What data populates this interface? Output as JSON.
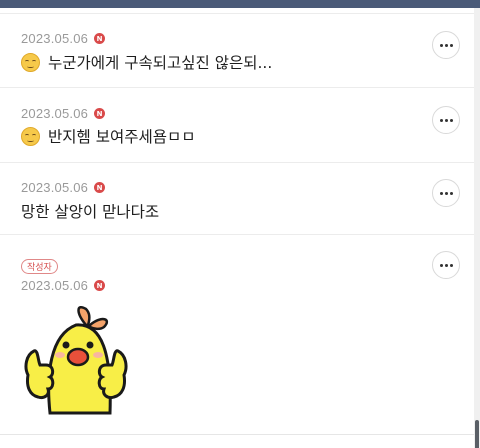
{
  "comments": [
    {
      "date": "2023.05.06",
      "badge": "N",
      "emoji": "relieved-emoji",
      "text": "누군가에게 구속되고싶진 않은되..."
    },
    {
      "date": "2023.05.06",
      "badge": "N",
      "emoji": "relieved-emoji",
      "text": "반지헴 보여주세욤ㅁㅁ"
    },
    {
      "date": "2023.05.06",
      "badge": "N",
      "text": "망한 살앙이 맏나다조"
    },
    {
      "author_tag": "작성자",
      "date": "2023.05.06",
      "badge": "N",
      "sticker": "chick-thumbs-up-sticker"
    }
  ],
  "colors": {
    "top_bar": "#4a5a78",
    "badge": "#d94a4a",
    "author_tag": "#d65050",
    "date_text": "#9a9a9a"
  },
  "icons": {
    "more": "more-dots-icon"
  }
}
